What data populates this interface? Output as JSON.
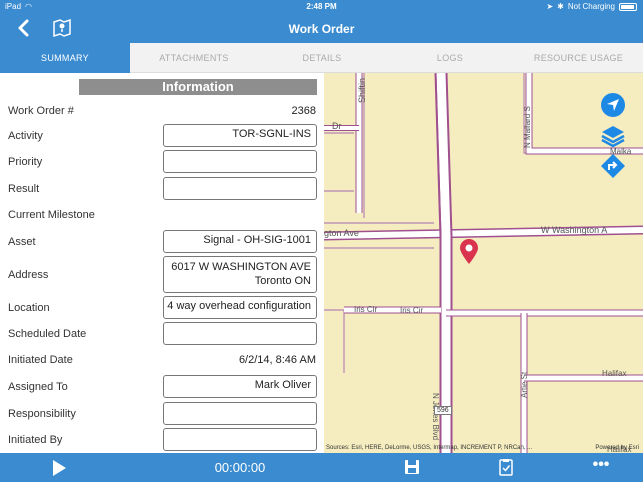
{
  "status_bar": {
    "device": "iPad",
    "time": "2:48 PM",
    "charging": "Not Charging"
  },
  "nav": {
    "title": "Work Order",
    "back_icon": "chevron-left-icon",
    "map_icon": "map-book-icon"
  },
  "tabs": [
    {
      "label": "SUMMARY",
      "active": true
    },
    {
      "label": "ATTACHMENTS",
      "active": false
    },
    {
      "label": "DETAILS",
      "active": false
    },
    {
      "label": "LOGS",
      "active": false
    },
    {
      "label": "RESOURCE USAGE",
      "active": false
    }
  ],
  "form": {
    "section_title": "Information",
    "fields": [
      {
        "label": "Work Order #",
        "value": "2368",
        "type": "text"
      },
      {
        "label": "Activity",
        "value": "TOR-SGNL-INS",
        "type": "box"
      },
      {
        "label": "Priority",
        "value": "",
        "type": "box"
      },
      {
        "label": "Result",
        "value": "",
        "type": "box"
      },
      {
        "label": "Current Milestone",
        "value": "",
        "type": "text"
      },
      {
        "label": "Asset",
        "value": "Signal - OH-SIG-1001",
        "type": "box"
      },
      {
        "label": "Address",
        "value_line1": "6017 W WASHINGTON AVE",
        "value_line2": "Toronto ON",
        "type": "box2"
      },
      {
        "label": "Location",
        "value": "4 way overhead configuration",
        "type": "box"
      },
      {
        "label": "Scheduled Date",
        "value": "",
        "type": "box"
      },
      {
        "label": "Initiated Date",
        "value": "6/2/14, 8:46 AM",
        "type": "text"
      },
      {
        "label": "Assigned To",
        "value": "Mark Oliver",
        "type": "box"
      },
      {
        "label": "Responsibility",
        "value": "",
        "type": "box"
      },
      {
        "label": "Initiated By",
        "value": "",
        "type": "box"
      }
    ]
  },
  "map": {
    "street_labels": {
      "washington_left": "gton Ave",
      "washington_right": "W Washington A",
      "shifting": "Shiftin",
      "dr": "Dr",
      "mallard": "N Mallard S",
      "malka": "Malka",
      "iris_left": "Iris Cir",
      "iris_right": "Iris Cir",
      "jones": "N Jones Blvd",
      "halifax": "Halifax",
      "halifax2": "Halifax",
      "artie": "Artie St",
      "route": "596"
    },
    "attribution": "Sources: Esri, HERE, DeLorme, USGS, Intermap, INCREMENT P, NRCan, ...",
    "powered_by": "Powered by Esri",
    "colors": {
      "land": "#f5edc0",
      "road": "#ffffff",
      "road_edge": "#a0508f",
      "marker": "#d9334d",
      "button": "#1e88e5"
    }
  },
  "toolbar": {
    "timer": "00:00:00",
    "play_icon": "play-icon",
    "save_icon": "save-icon",
    "checklist_icon": "checklist-icon",
    "more_icon": "more-icon",
    "more_label": "•••"
  }
}
